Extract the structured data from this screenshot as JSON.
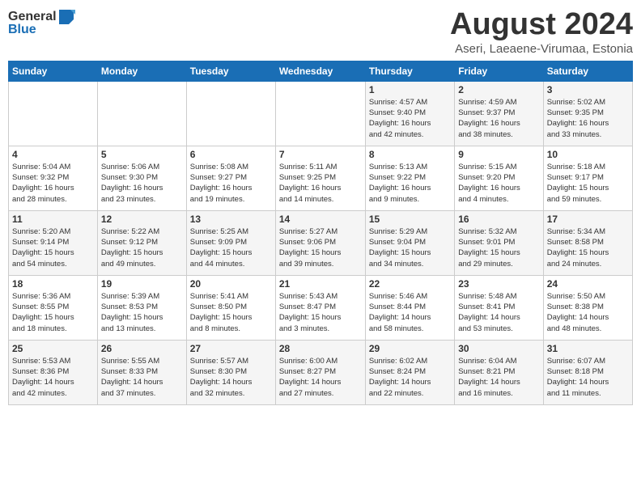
{
  "logo": {
    "general": "General",
    "blue": "Blue"
  },
  "calendar": {
    "title": "August 2024",
    "subtitle": "Aseri, Laeaene-Virumaa, Estonia"
  },
  "days_of_week": [
    "Sunday",
    "Monday",
    "Tuesday",
    "Wednesday",
    "Thursday",
    "Friday",
    "Saturday"
  ],
  "weeks": [
    [
      {
        "day": "",
        "info": ""
      },
      {
        "day": "",
        "info": ""
      },
      {
        "day": "",
        "info": ""
      },
      {
        "day": "",
        "info": ""
      },
      {
        "day": "1",
        "info": "Sunrise: 4:57 AM\nSunset: 9:40 PM\nDaylight: 16 hours\nand 42 minutes."
      },
      {
        "day": "2",
        "info": "Sunrise: 4:59 AM\nSunset: 9:37 PM\nDaylight: 16 hours\nand 38 minutes."
      },
      {
        "day": "3",
        "info": "Sunrise: 5:02 AM\nSunset: 9:35 PM\nDaylight: 16 hours\nand 33 minutes."
      }
    ],
    [
      {
        "day": "4",
        "info": "Sunrise: 5:04 AM\nSunset: 9:32 PM\nDaylight: 16 hours\nand 28 minutes."
      },
      {
        "day": "5",
        "info": "Sunrise: 5:06 AM\nSunset: 9:30 PM\nDaylight: 16 hours\nand 23 minutes."
      },
      {
        "day": "6",
        "info": "Sunrise: 5:08 AM\nSunset: 9:27 PM\nDaylight: 16 hours\nand 19 minutes."
      },
      {
        "day": "7",
        "info": "Sunrise: 5:11 AM\nSunset: 9:25 PM\nDaylight: 16 hours\nand 14 minutes."
      },
      {
        "day": "8",
        "info": "Sunrise: 5:13 AM\nSunset: 9:22 PM\nDaylight: 16 hours\nand 9 minutes."
      },
      {
        "day": "9",
        "info": "Sunrise: 5:15 AM\nSunset: 9:20 PM\nDaylight: 16 hours\nand 4 minutes."
      },
      {
        "day": "10",
        "info": "Sunrise: 5:18 AM\nSunset: 9:17 PM\nDaylight: 15 hours\nand 59 minutes."
      }
    ],
    [
      {
        "day": "11",
        "info": "Sunrise: 5:20 AM\nSunset: 9:14 PM\nDaylight: 15 hours\nand 54 minutes."
      },
      {
        "day": "12",
        "info": "Sunrise: 5:22 AM\nSunset: 9:12 PM\nDaylight: 15 hours\nand 49 minutes."
      },
      {
        "day": "13",
        "info": "Sunrise: 5:25 AM\nSunset: 9:09 PM\nDaylight: 15 hours\nand 44 minutes."
      },
      {
        "day": "14",
        "info": "Sunrise: 5:27 AM\nSunset: 9:06 PM\nDaylight: 15 hours\nand 39 minutes."
      },
      {
        "day": "15",
        "info": "Sunrise: 5:29 AM\nSunset: 9:04 PM\nDaylight: 15 hours\nand 34 minutes."
      },
      {
        "day": "16",
        "info": "Sunrise: 5:32 AM\nSunset: 9:01 PM\nDaylight: 15 hours\nand 29 minutes."
      },
      {
        "day": "17",
        "info": "Sunrise: 5:34 AM\nSunset: 8:58 PM\nDaylight: 15 hours\nand 24 minutes."
      }
    ],
    [
      {
        "day": "18",
        "info": "Sunrise: 5:36 AM\nSunset: 8:55 PM\nDaylight: 15 hours\nand 18 minutes."
      },
      {
        "day": "19",
        "info": "Sunrise: 5:39 AM\nSunset: 8:53 PM\nDaylight: 15 hours\nand 13 minutes."
      },
      {
        "day": "20",
        "info": "Sunrise: 5:41 AM\nSunset: 8:50 PM\nDaylight: 15 hours\nand 8 minutes."
      },
      {
        "day": "21",
        "info": "Sunrise: 5:43 AM\nSunset: 8:47 PM\nDaylight: 15 hours\nand 3 minutes."
      },
      {
        "day": "22",
        "info": "Sunrise: 5:46 AM\nSunset: 8:44 PM\nDaylight: 14 hours\nand 58 minutes."
      },
      {
        "day": "23",
        "info": "Sunrise: 5:48 AM\nSunset: 8:41 PM\nDaylight: 14 hours\nand 53 minutes."
      },
      {
        "day": "24",
        "info": "Sunrise: 5:50 AM\nSunset: 8:38 PM\nDaylight: 14 hours\nand 48 minutes."
      }
    ],
    [
      {
        "day": "25",
        "info": "Sunrise: 5:53 AM\nSunset: 8:36 PM\nDaylight: 14 hours\nand 42 minutes."
      },
      {
        "day": "26",
        "info": "Sunrise: 5:55 AM\nSunset: 8:33 PM\nDaylight: 14 hours\nand 37 minutes."
      },
      {
        "day": "27",
        "info": "Sunrise: 5:57 AM\nSunset: 8:30 PM\nDaylight: 14 hours\nand 32 minutes."
      },
      {
        "day": "28",
        "info": "Sunrise: 6:00 AM\nSunset: 8:27 PM\nDaylight: 14 hours\nand 27 minutes."
      },
      {
        "day": "29",
        "info": "Sunrise: 6:02 AM\nSunset: 8:24 PM\nDaylight: 14 hours\nand 22 minutes."
      },
      {
        "day": "30",
        "info": "Sunrise: 6:04 AM\nSunset: 8:21 PM\nDaylight: 14 hours\nand 16 minutes."
      },
      {
        "day": "31",
        "info": "Sunrise: 6:07 AM\nSunset: 8:18 PM\nDaylight: 14 hours\nand 11 minutes."
      }
    ]
  ]
}
